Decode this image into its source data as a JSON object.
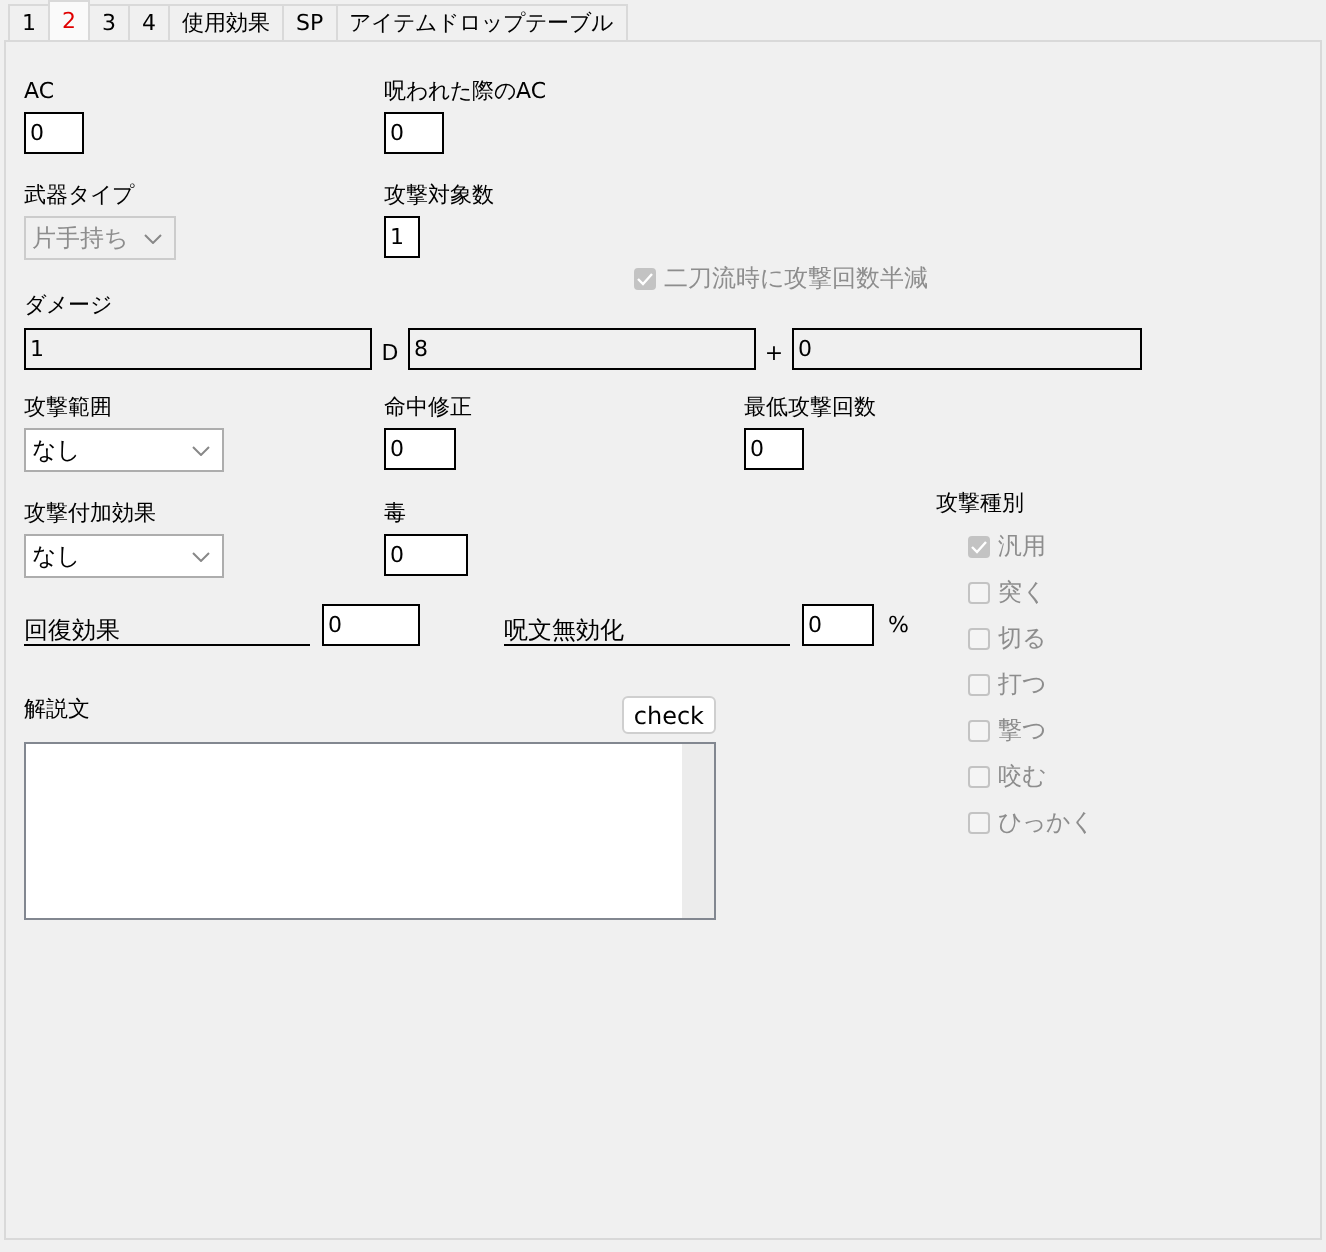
{
  "tabs": [
    {
      "label": "1",
      "selected": false
    },
    {
      "label": "2",
      "selected": true
    },
    {
      "label": "3",
      "selected": false
    },
    {
      "label": "4",
      "selected": false
    },
    {
      "label": "使用効果",
      "selected": false
    },
    {
      "label": "SP",
      "selected": false
    },
    {
      "label": "アイテムドロップテーブル",
      "selected": false
    }
  ],
  "ac": {
    "label": "AC",
    "value": "0"
  },
  "cursed_ac": {
    "label": "呪われた際のAC",
    "value": "0"
  },
  "weapon_type": {
    "label": "武器タイプ",
    "value": "片手持ち",
    "disabled": true
  },
  "target_count": {
    "label": "攻撃対象数",
    "value": "1"
  },
  "dual_wield_halve": {
    "label": "二刀流時に攻撃回数半減",
    "checked": true,
    "disabled": true
  },
  "damage": {
    "label": "ダメージ",
    "dice_count": "1",
    "d_label": "D",
    "dice_sides": "8",
    "plus_label": "+",
    "bonus": "0"
  },
  "attack_range": {
    "label": "攻撃範囲",
    "value": "なし",
    "disabled": false
  },
  "hit_modifier": {
    "label": "命中修正",
    "value": "0"
  },
  "min_attacks": {
    "label": "最低攻撃回数",
    "value": "0"
  },
  "attack_effect": {
    "label": "攻撃付加効果",
    "value": "なし",
    "disabled": false
  },
  "poison": {
    "label": "毒",
    "value": "0"
  },
  "recovery": {
    "label": "回復効果",
    "value": "0"
  },
  "spell_nullify": {
    "label": "呪文無効化",
    "value": "0",
    "unit": "%"
  },
  "attack_types": {
    "label": "攻撃種別",
    "items": [
      {
        "label": "汎用",
        "checked": true,
        "disabled": true
      },
      {
        "label": "突く",
        "checked": false,
        "disabled": true
      },
      {
        "label": "切る",
        "checked": false,
        "disabled": true
      },
      {
        "label": "打つ",
        "checked": false,
        "disabled": true
      },
      {
        "label": "撃つ",
        "checked": false,
        "disabled": true
      },
      {
        "label": "咬む",
        "checked": false,
        "disabled": true
      },
      {
        "label": "ひっかく",
        "checked": false,
        "disabled": true
      }
    ]
  },
  "description": {
    "label": "解説文",
    "button": "check"
  }
}
